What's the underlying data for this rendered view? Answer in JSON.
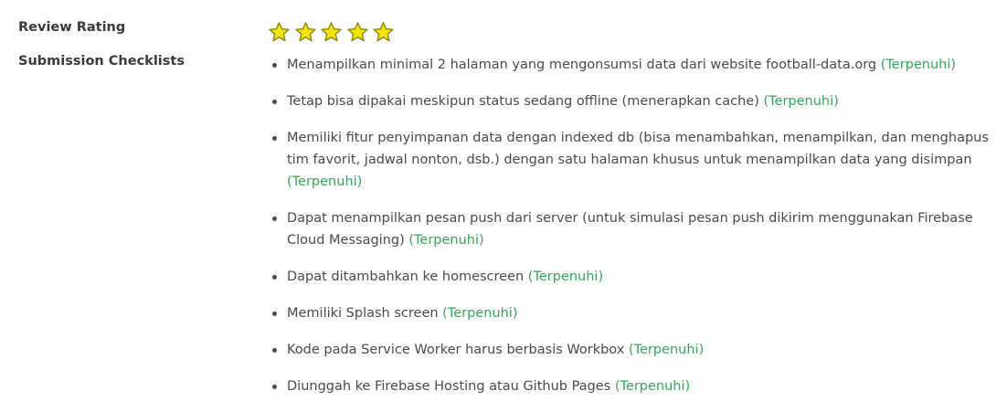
{
  "rating": {
    "label": "Review Rating",
    "stars": 5,
    "max_stars": 5,
    "star_color": "#f5e50f",
    "star_outline_color": "#8c8a1a"
  },
  "checklist": {
    "label": "Submission Checklists",
    "status_color": "#3aa35b",
    "items": [
      {
        "text": "Menampilkan minimal 2 halaman yang mengonsumsi data dari website football-data.org",
        "status": "(Terpenuhi)"
      },
      {
        "text": "Tetap bisa dipakai meskipun status sedang offline (menerapkan cache)",
        "status": "(Terpenuhi)"
      },
      {
        "text": "Memiliki fitur penyimpanan data dengan indexed db (bisa menambahkan, menampilkan, dan menghapus tim favorit, jadwal nonton, dsb.) dengan satu halaman khusus untuk menampilkan data yang disimpan",
        "status": "(Terpenuhi)"
      },
      {
        "text": "Dapat menampilkan pesan push dari server (untuk simulasi pesan push dikirim menggunakan Firebase Cloud Messaging)",
        "status": "(Terpenuhi)"
      },
      {
        "text": "Dapat ditambahkan ke homescreen",
        "status": "(Terpenuhi)"
      },
      {
        "text": "Memiliki Splash screen",
        "status": "(Terpenuhi)"
      },
      {
        "text": "Kode pada Service Worker harus berbasis Workbox",
        "status": "(Terpenuhi)"
      },
      {
        "text": "Diunggah ke Firebase Hosting atau Github Pages",
        "status": "(Terpenuhi)"
      }
    ]
  }
}
